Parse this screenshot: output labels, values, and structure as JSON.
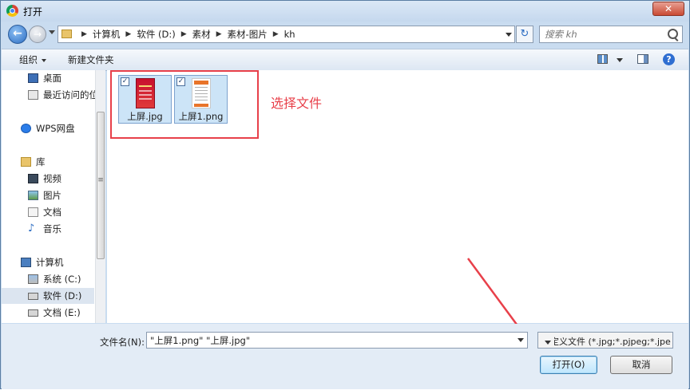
{
  "window": {
    "title": "打开",
    "close_glyph": "✕"
  },
  "nav": {
    "back_glyph": "←",
    "forward_glyph": "→",
    "refresh_glyph": "↻"
  },
  "address": {
    "crumbs": [
      "计算机",
      "软件 (D:)",
      "素材",
      "素材-图片",
      "kh"
    ]
  },
  "search": {
    "placeholder": "搜索 kh"
  },
  "toolbar": {
    "organize_label": "组织",
    "new_folder_label": "新建文件夹",
    "help_glyph": "?"
  },
  "sidebar": {
    "items": [
      {
        "label": "桌面",
        "icon": "desktop-icon"
      },
      {
        "label": "最近访问的位",
        "icon": "recent-places-icon"
      },
      {
        "label": "WPS网盘",
        "icon": "wps-cloud-icon"
      },
      {
        "label": "库",
        "icon": "library-icon"
      },
      {
        "label": "视频",
        "icon": "video-icon"
      },
      {
        "label": "图片",
        "icon": "pictures-icon"
      },
      {
        "label": "文档",
        "icon": "documents-icon"
      },
      {
        "label": "音乐",
        "icon": "music-icon"
      },
      {
        "label": "计算机",
        "icon": "computer-icon"
      },
      {
        "label": "系统 (C:)",
        "icon": "system-drive-icon"
      },
      {
        "label": "软件 (D:)",
        "icon": "drive-icon",
        "selected": true
      },
      {
        "label": "文档 (E:)",
        "icon": "drive-icon"
      }
    ]
  },
  "files": [
    {
      "name": "上屏.jpg",
      "checked": true,
      "icon": "image-thumbnail-icon"
    },
    {
      "name": "上屏1.png",
      "checked": true,
      "icon": "image-thumbnail-icon"
    }
  ],
  "annotation": {
    "text": "选择文件",
    "color": "#e8404a"
  },
  "footer": {
    "filename_label": "文件名(N):",
    "filename_value": "\"上屏1.png\" \"上屏.jpg\"",
    "filter_value": "自定义文件 (*.jpg;*.pjpeg;*.jpe",
    "open_label": "打开(O)",
    "cancel_label": "取消"
  },
  "colors": {
    "window_frame": "#c9dcf0",
    "selection": "#cce4f7",
    "annotation": "#e8404a"
  }
}
